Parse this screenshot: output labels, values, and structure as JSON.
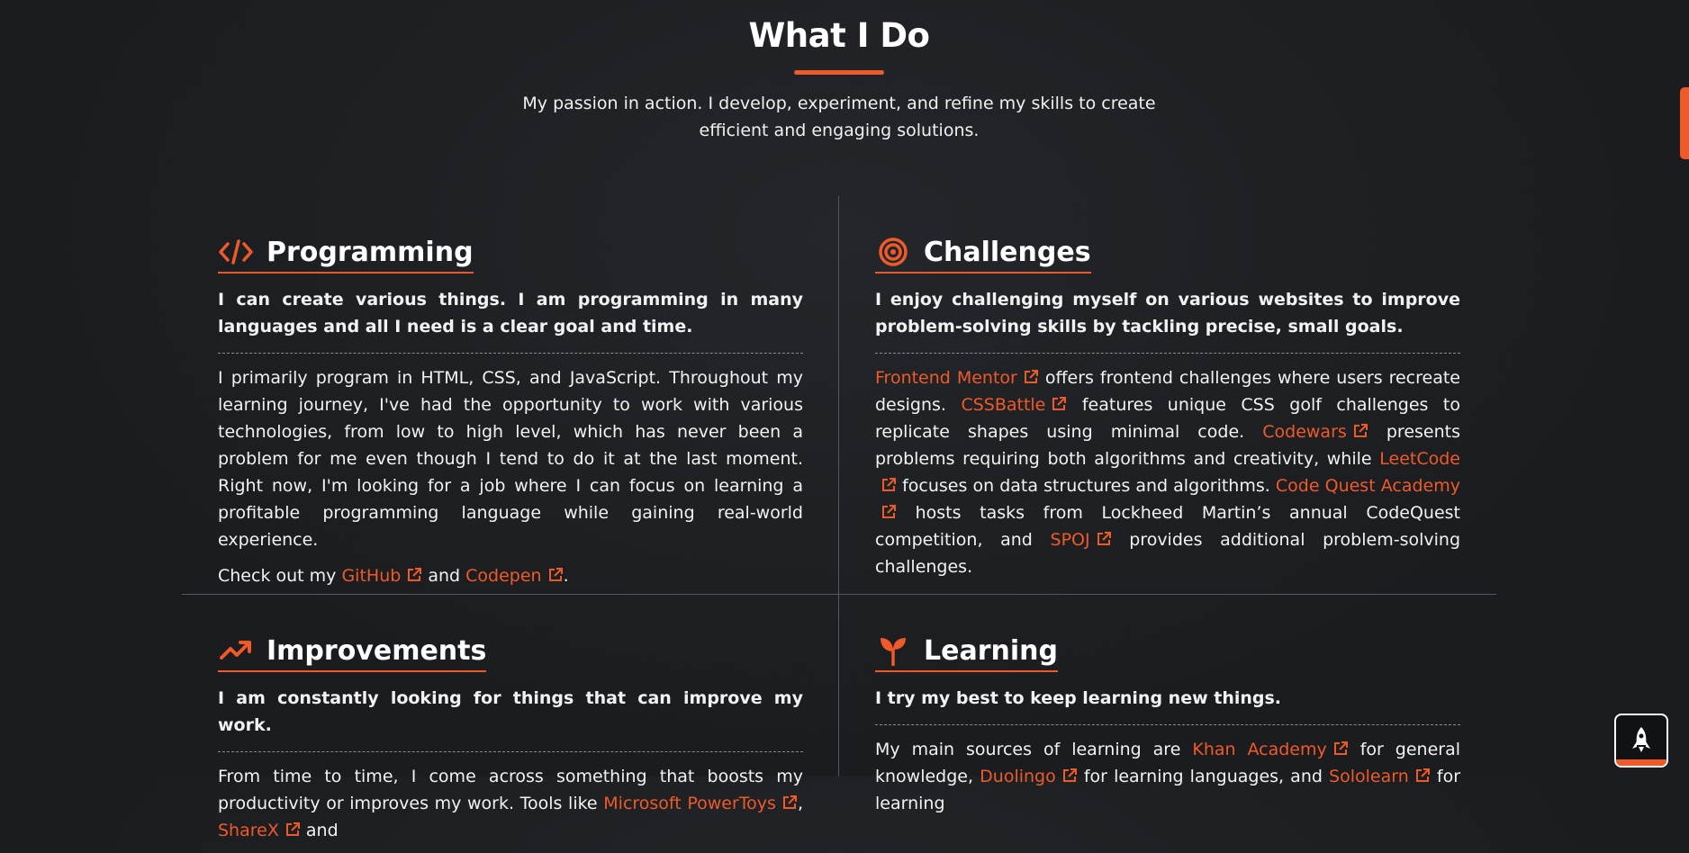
{
  "header": {
    "title": "What I Do",
    "subtitle": "My passion in action. I develop, experiment, and refine my skills to create efficient and engaging solutions."
  },
  "colors": {
    "accent": "#f05a28",
    "background": "#1b1d20",
    "text": "#f2f2f2"
  },
  "cards": [
    {
      "icon": "code-icon",
      "title": "Programming",
      "lead": "I can create various things. I am programming in many languages and all I need is a clear goal and time.",
      "body": "I primarily program in HTML, CSS, and JavaScript. Throughout my learning journey, I've had the opportunity to work with various technologies, from low to high level, which has never been a problem for me even though I tend to do it at the last moment. Right now, I'm looking for a job where I can focus on learning a profitable programming language while gaining real-world experience.",
      "check_prefix": "Check out my",
      "link1": "GitHub",
      "and_text": "and",
      "link2": "Codepen",
      "suffix": "."
    },
    {
      "icon": "target-icon",
      "title": "Challenges",
      "lead": "I enjoy challenging myself on various websites to improve problem-solving skills by tackling precise, small goals.",
      "links": [
        "Frontend Mentor",
        "CSSBattle",
        "Codewars",
        "LeetCode",
        "Code Quest Academy",
        "SPOJ"
      ],
      "texts": [
        "offers frontend challenges where users recreate designs.",
        "features unique CSS golf challenges to replicate shapes using minimal code.",
        "presents problems requiring both algorithms and creativity, while",
        "focuses on data structures and algorithms.",
        "hosts tasks from Lockheed Martin’s annual CodeQuest competition, and",
        "provides additional problem-solving challenges."
      ]
    },
    {
      "icon": "trending-up-icon",
      "title": "Improvements",
      "lead": "I am constantly looking for things that can improve my work.",
      "body_prefix": "From time to time, I come across something that boosts my productivity or improves my work. Tools like",
      "link1": "Microsoft PowerToys",
      "link2": "ShareX",
      "body_suffix": "and"
    },
    {
      "icon": "sprout-icon",
      "title": "Learning",
      "lead": "I try my best to keep learning new things.",
      "body_prefix": "My main sources of learning are",
      "link1": "Khan Academy",
      "mid1": "for general knowledge,",
      "link2": "Duolingo",
      "mid2": "for learning languages, and",
      "link3": "Sololearn",
      "mid3": "for learning"
    }
  ],
  "controls": {
    "back_to_top_icon": "rocket-icon"
  }
}
